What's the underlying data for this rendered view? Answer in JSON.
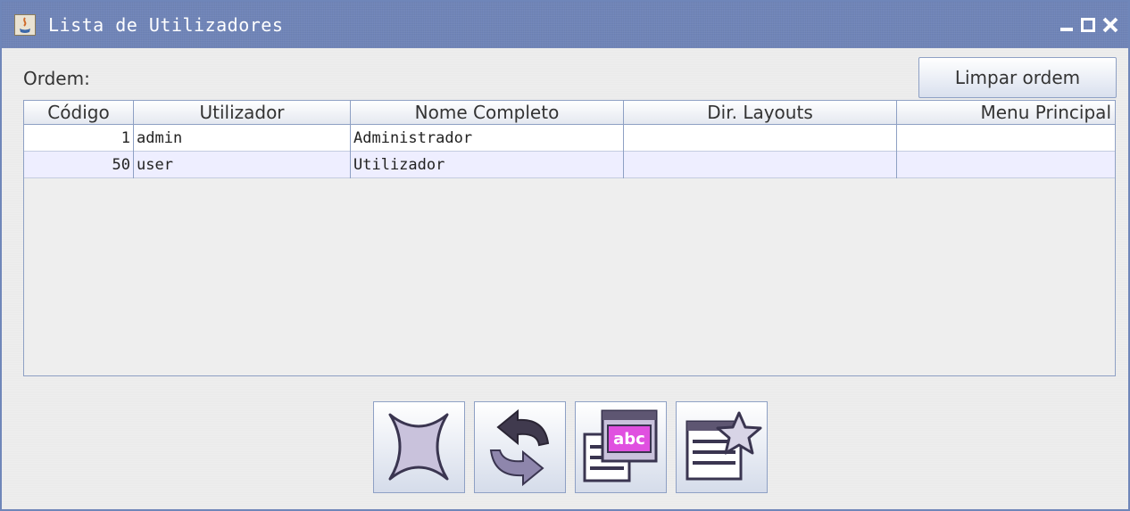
{
  "window": {
    "title": "Lista de Utilizadores",
    "icons": {
      "app": "java-app-icon",
      "minimize": "minimize-icon",
      "maximize": "maximize-icon",
      "close": "close-icon"
    }
  },
  "order": {
    "label": "Ordem:",
    "clear_button": "Limpar ordem"
  },
  "table": {
    "columns": [
      "Código",
      "Utilizador",
      "Nome Completo",
      "Dir. Layouts",
      "Menu Principal"
    ],
    "rows": [
      [
        "1",
        "admin",
        "Administrador",
        "",
        ""
      ],
      [
        "50",
        "user",
        "Utilizador",
        "",
        ""
      ]
    ],
    "selected_row_color": "#eeeeff"
  },
  "toolbar": {
    "buttons": [
      {
        "icon": "close-x-icon"
      },
      {
        "icon": "refresh-icon"
      },
      {
        "icon": "rename-text-icon",
        "text": "abc"
      },
      {
        "icon": "favorite-list-icon"
      }
    ]
  },
  "colors": {
    "titlebar": "#6f84b8",
    "accent_border": "#8ea0c4",
    "icon_fill": "#c9c2dc",
    "icon_magenta": "#e050e0"
  }
}
